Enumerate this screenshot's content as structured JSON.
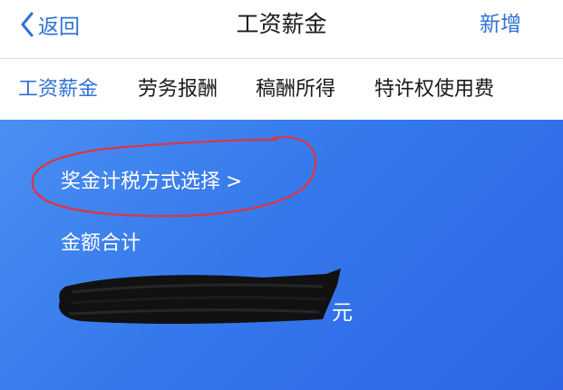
{
  "navbar": {
    "back_label": "返回",
    "title": "工资薪金",
    "action_label": "新增"
  },
  "tabs": [
    {
      "label": "工资薪金",
      "active": true
    },
    {
      "label": "劳务报酬",
      "active": false
    },
    {
      "label": "稿酬所得",
      "active": false
    },
    {
      "label": "特许权使用费",
      "active": false
    }
  ],
  "panel": {
    "method_link": "奖金计税方式选择",
    "method_chevron": ">",
    "total_label": "金额合计",
    "unit": "元"
  },
  "colors": {
    "accent": "#2f71d6",
    "panel_blue": "#3578ec",
    "annotation_red": "#e0343f",
    "redaction": "#111111"
  },
  "icons": {
    "back": "chevron-left-icon",
    "method": "chevron-right-icon"
  }
}
